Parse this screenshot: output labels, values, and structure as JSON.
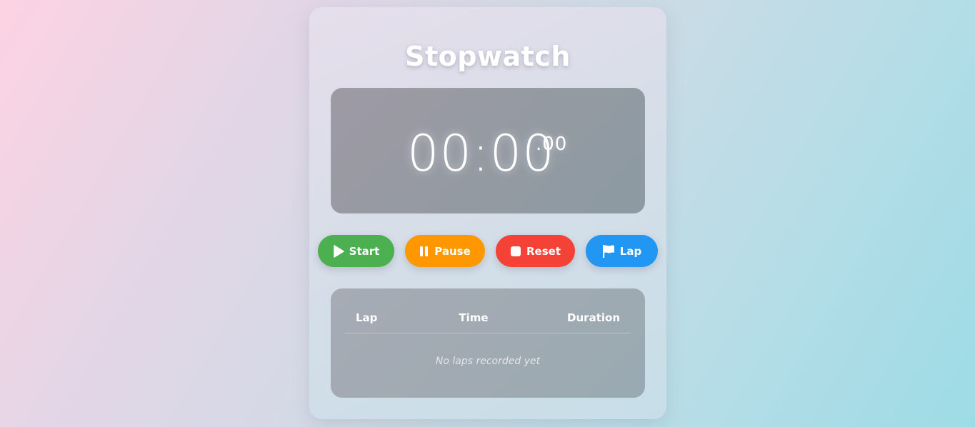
{
  "app": {
    "title": "Stopwatch"
  },
  "display": {
    "main": "00:00",
    "fraction": ".00"
  },
  "controls": {
    "start_label": "Start",
    "pause_label": "Pause",
    "reset_label": "Reset",
    "lap_label": "Lap",
    "icons": {
      "start": "play-icon",
      "pause": "pause-icon",
      "reset": "stop-icon",
      "lap": "flag-icon"
    },
    "colors": {
      "start": "#4caf50",
      "pause": "#ff9800",
      "reset": "#f44336",
      "lap": "#2196f3"
    }
  },
  "laps": {
    "columns": [
      "Lap",
      "Time",
      "Duration"
    ],
    "rows": [],
    "empty_message": "No laps recorded yet"
  }
}
